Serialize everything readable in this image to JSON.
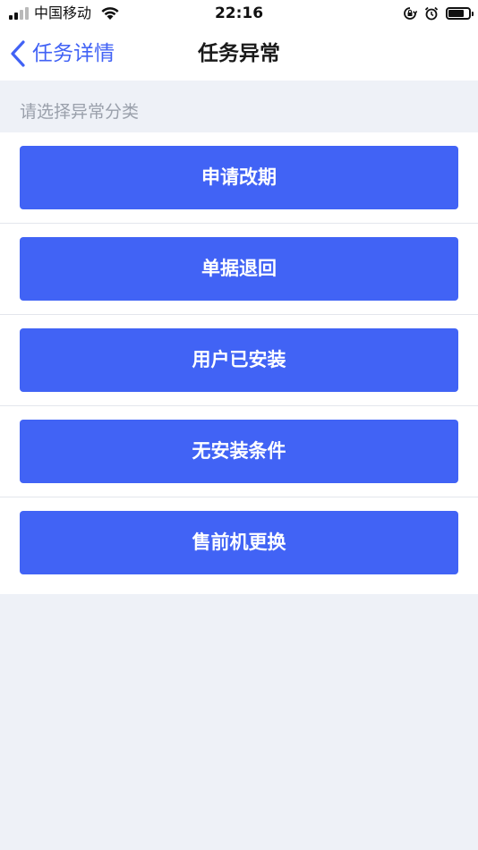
{
  "status_bar": {
    "carrier": "中国移动",
    "time": "22:16",
    "icons": [
      "signal-icon",
      "wifi-icon",
      "orientation-lock-icon",
      "alarm-icon",
      "battery-icon"
    ],
    "battery_level": 0.7
  },
  "nav": {
    "back_label": "任务详情",
    "title": "任务异常",
    "back_icon": "chevron-left-icon"
  },
  "section": {
    "label": "请选择异常分类"
  },
  "options": [
    {
      "label": "申请改期"
    },
    {
      "label": "单据退回"
    },
    {
      "label": "用户已安装"
    },
    {
      "label": "无安装条件"
    },
    {
      "label": "售前机更换"
    }
  ],
  "colors": {
    "accent": "#4163f5",
    "background": "#eef1f7",
    "card": "#ffffff",
    "muted_text": "#9aa0ab"
  }
}
